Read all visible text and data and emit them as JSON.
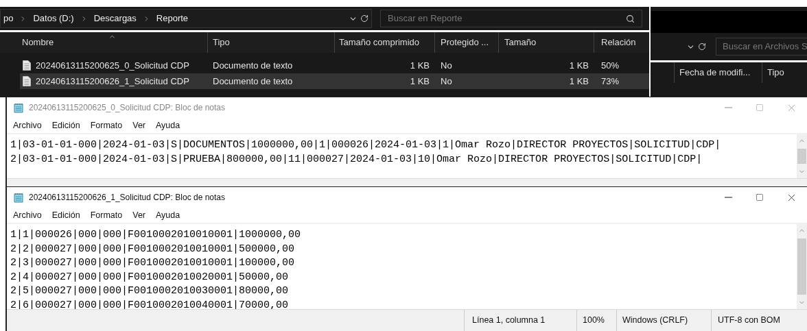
{
  "explorer": {
    "breadcrumb": [
      "po",
      "Datos (D:)",
      "Descargas",
      "Reporte"
    ],
    "search": {
      "placeholder": "Buscar en Reporte"
    },
    "columns": [
      "Nombre",
      "Tipo",
      "Tamaño comprimido",
      "Protegido ...",
      "Tamaño",
      "Relación"
    ],
    "rows": [
      {
        "name": "20240613115200625_0_Solicitud CDP",
        "type": "Documento de texto",
        "compressed": "1 KB",
        "protected": "No",
        "size": "1 KB",
        "ratio": "50%",
        "selected": false
      },
      {
        "name": "20240613115200626_1_Solicitud CDP",
        "type": "Documento de texto",
        "compressed": "1 KB",
        "protected": "No",
        "size": "1 KB",
        "ratio": "73%",
        "selected": true
      }
    ]
  },
  "explorer_behind": {
    "search": {
      "placeholder": "Buscar en Archivos S"
    },
    "columns": [
      "Fecha de modifi...",
      "Tipo"
    ]
  },
  "notepads": [
    {
      "title": "20240613115200625_0_Solicitud CDP: Bloc de notas",
      "active": false,
      "menu": [
        "Archivo",
        "Edición",
        "Formato",
        "Ver",
        "Ayuda"
      ],
      "lines": [
        "1|03-01-01-000|2024-01-03|S|DOCUMENTOS|1000000,00|1|000026|2024-01-03|1|Omar Rozo|DIRECTOR PROYECTOS|SOLICITUD|CDP|",
        "2|03-01-01-000|2024-01-03|S|PRUEBA|800000,00|11|000027|2024-01-03|10|Omar Rozo|DIRECTOR PROYECTOS|SOLICITUD|CDP|"
      ]
    },
    {
      "title": "20240613115200626_1_Solicitud CDP: Bloc de notas",
      "active": true,
      "menu": [
        "Archivo",
        "Edición",
        "Formato",
        "Ver",
        "Ayuda"
      ],
      "lines": [
        "1|1|000026|000|000|F0010002010010001|1000000,00",
        "2|2|000027|000|000|F0010002010010001|500000,00",
        "2|3|000027|000|000|F0010002010010001|100000,00",
        "2|4|000027|000|000|F0010002010020001|50000,00",
        "2|5|000027|000|000|F0010002010030001|80000,00",
        "2|6|000027|000|000|F0010002010040001|70000,00"
      ],
      "status": [
        "Línea 1, columna 1",
        "100%",
        "Windows (CRLF)",
        "UTF-8 con BOM"
      ]
    }
  ]
}
